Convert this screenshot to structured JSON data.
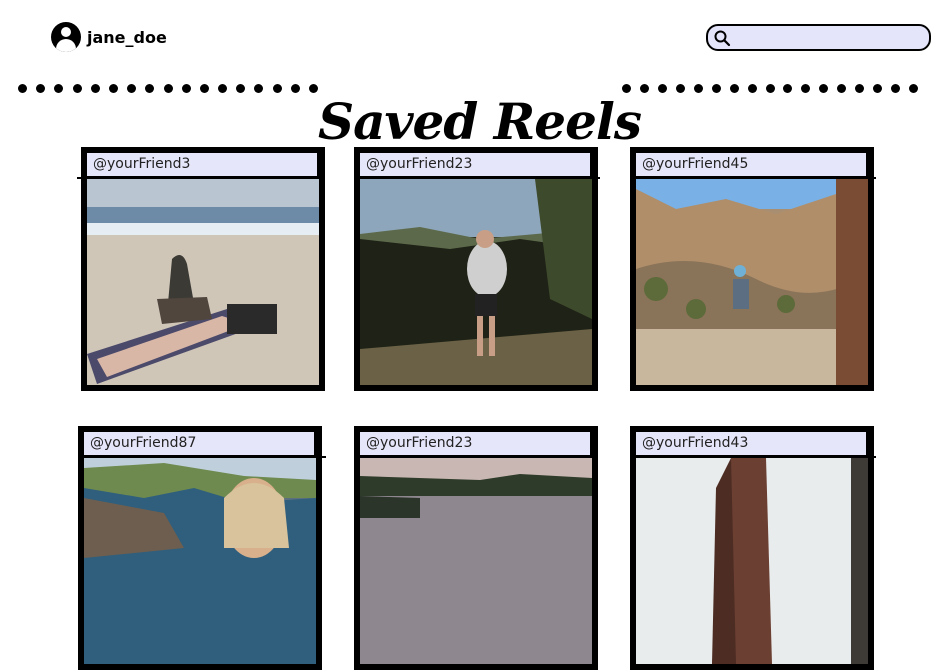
{
  "header": {
    "username": "jane_doe",
    "avatar_icon": "user-avatar-icon",
    "search": {
      "placeholder": "",
      "value": "",
      "icon": "search-icon",
      "background": "#e4e4fb"
    }
  },
  "page": {
    "title": "Saved Reels"
  },
  "reels": [
    {
      "handle": "@yourFriend3"
    },
    {
      "handle": "@yourFriend23"
    },
    {
      "handle": "@yourFriend45"
    },
    {
      "handle": "@yourFriend87"
    },
    {
      "handle": "@yourFriend23"
    },
    {
      "handle": "@yourFriend43"
    }
  ]
}
